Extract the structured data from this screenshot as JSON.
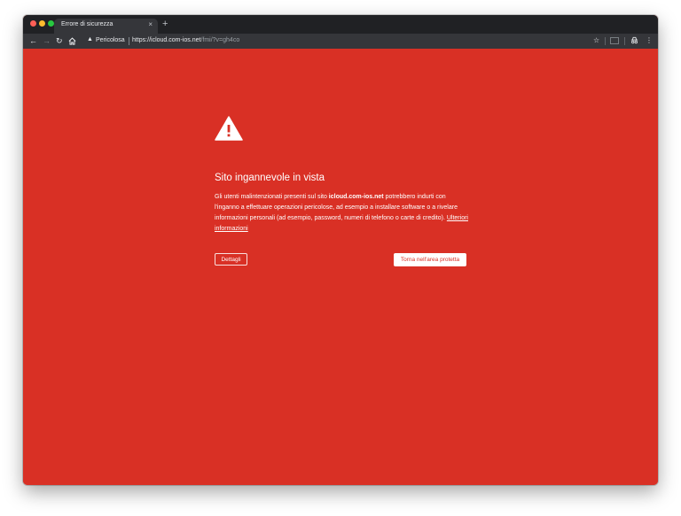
{
  "window": {
    "traffic_colors": {
      "close": "#ff5f57",
      "minimize": "#febc2e",
      "maximize": "#28c840"
    }
  },
  "tab": {
    "title": "Errore di sicurezza",
    "close_glyph": "×",
    "new_tab_glyph": "+"
  },
  "toolbar": {
    "icons": {
      "back": "back-arrow-icon",
      "forward": "forward-arrow-icon",
      "reload": "reload-icon",
      "home": "home-icon",
      "bookmark": "star-icon",
      "cast": "cast-icon",
      "profile": "incognito-icon",
      "menu": "kebab-menu-icon"
    }
  },
  "omnibox": {
    "security_label": "Pericolosa",
    "url_scheme_host": "https://icloud.com-ios.net",
    "url_rest": "/fmi/?v=gh4co"
  },
  "interstitial": {
    "background_color": "#d93025",
    "heading": "Sito ingannevole in vista",
    "body_before": "Gli utenti malintenzionati presenti sul sito ",
    "body_domain": "icloud.com-ios.net",
    "body_after": " potrebbero indurti con l'inganno a effettuare operazioni pericolose, ad esempio a installare software o a rivelare informazioni personali (ad esempio, password, numeri di telefono o carte di credito). ",
    "learn_more_link": "Ulteriori informazioni",
    "details_button": "Dettagli",
    "back_button": "Torna nell'area protetta"
  }
}
